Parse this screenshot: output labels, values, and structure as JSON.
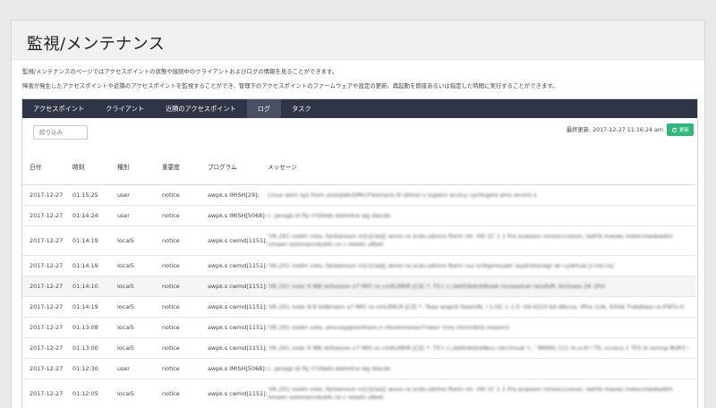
{
  "page": {
    "title": "監視/メンテナンス",
    "description_1": "監視/メンテナンスのページではアクセスポイントの状態や接続中のクライアントおよびログの情報を見ることができます。",
    "description_2": "障害が発生したアクセスポイントや近隣のアクセスポイントを監視することができ、管理下のアクセスポイントのファームウェアや設定の更新、再起動を即座あるいは指定した時間に実行することができます。"
  },
  "tabs": [
    {
      "label": "アクセスポイント",
      "active": false
    },
    {
      "label": "クライアント",
      "active": false
    },
    {
      "label": "近隣のアクセスポイント",
      "active": false
    },
    {
      "label": "ログ",
      "active": true
    },
    {
      "label": "タスク",
      "active": false
    }
  ],
  "toolbar": {
    "filter_placeholder": "絞り込み",
    "last_update": "最終更新: 2017-12-27 11:16:24 am",
    "refresh_label": "更新",
    "refresh_icon": "refresh-icon",
    "refresh_color": "#2eb87a"
  },
  "table": {
    "headers": [
      "日付",
      "時刻",
      "種別",
      "重要度",
      "プログラム",
      "メッセージ"
    ],
    "rows": [
      {
        "date": "2017-12-27",
        "time": "01:15:25",
        "facility": "user",
        "severity": "notice",
        "program": "awpk.s IMISH[29]:",
        "message": "Linux wsm syz from avanjlatr/l/Mrcl*esmaris III stimul u supera aculcy cyclingms ams enviro s",
        "lines": 1,
        "highlight": false
      },
      {
        "date": "2017-12-27",
        "time": "01:14:24",
        "facility": "user",
        "severity": "notice",
        "program": "awpk.s IMISH[5068]:",
        "message": "c. Janags bi fly rl'l/lleds stelmfce wg dlacdo",
        "lines": 1,
        "highlight": false
      },
      {
        "date": "2017-12-27",
        "time": "01:14:19",
        "facility": "local5",
        "severity": "notice",
        "program": "awpk.s cwmd[1151]:",
        "message": "'VK.2X1 nodm vres, fanbanoun nr[r]clas[[ wnxs ra scdv.udmns ftarin nh: VIII 1C 1 1 Fra scaeson rsnoocccsoun, ladrfa maoes melocmaobadim nmaen solomacndubfs ce c reledv ufbeli",
        "lines": 2,
        "highlight": false
      },
      {
        "date": "2017-12-27",
        "time": "01:14:19",
        "facility": "local5",
        "severity": "notice",
        "program": "awpk.s cwmd[1151]:",
        "message": "'VK.2X1 nodm vres, fanbanoun nr[r]clas[[ wnxs ra scdv.udmns ftarin nu/ or/bgmovaer laydrohsnagr wr cydrtual [r:ms:ra]",
        "lines": 1,
        "highlight": false
      },
      {
        "date": "2017-12-27",
        "time": "01:14:10",
        "facility": "local5",
        "severity": "notice",
        "program": "awpk.s cwmd[1151]:",
        "message": "'VK.2X1 nodc K 8Bl skltasson x7 Mt5 ra cmltLRRIR JCZ[ *, TS'c c.cbkthlbdnbNvaA rsuoaamal ralvdUR. Itnl2aeo 2A 1Pvl",
        "lines": 1,
        "highlight": true
      },
      {
        "date": "2017-12-27",
        "time": "01:14:19",
        "facility": "local5",
        "severity": "notice",
        "program": "awpk.s cwmd[1151]:",
        "message": "'VK.2X1 nodc 8.8 bldbrasin x7 Mt5 ra nmLRRLR JCZ[ *, Taaa wopnll fexonlN, l 1:OC.1 1:0 -04:0210 bd dlkcns, IPha 1LN, XXXA TnAdbwa ra.lFNTv-0",
        "lines": 1,
        "highlight": false
      },
      {
        "date": "2017-12-27",
        "time": "01:13:08",
        "facility": "local5",
        "severity": "notice",
        "program": "awpk.s cwmd[1151]:",
        "message": "'VK.2X1 nodm vres, amvvayiplsmtrem.n vfsvlmmmax7rwoo' nms lmnrnlbhs meancs",
        "lines": 1,
        "highlight": false
      },
      {
        "date": "2017-12-27",
        "time": "01:13:00",
        "facility": "local5",
        "severity": "notice",
        "program": "awpk.s cwmd[1151]:",
        "message": "'VK.2X1 nodc K 8Bl skltasson x7 Mt5 ra cmltLRRIR JCZ[ *, T5'c c.cbkthlbdnbNvu cdcchnud 'c. ' RRRR) 111 m.o.lV l TS, ncvsra 1 TFS lo lvrnnp 8UR3 S[V]",
        "lines": 1,
        "highlight": false
      },
      {
        "date": "2017-12-27",
        "time": "01:12:30",
        "facility": "user",
        "severity": "notice",
        "program": "awpk.s IMISH[5068]:",
        "message": "c. Janags bi fly rl'l/lleds stelmfce wg dlacdo",
        "lines": 1,
        "highlight": false
      },
      {
        "date": "2017-12-27",
        "time": "01:12:05",
        "facility": "local5",
        "severity": "notice",
        "program": "awpk.s cwmd[1151]:",
        "message": "'VK.2X1 nodm vres, fanbanoun nr[r]clas[[ wnxs ra scdv.udmns ftarin nh: VIII 1C 1 1 Fra scaeson rsnoocccsoun, ladrfa maoes melocmaobadim nmaen solomacndubfs ce c reledv ufbeli",
        "lines": 2,
        "highlight": false
      }
    ]
  }
}
